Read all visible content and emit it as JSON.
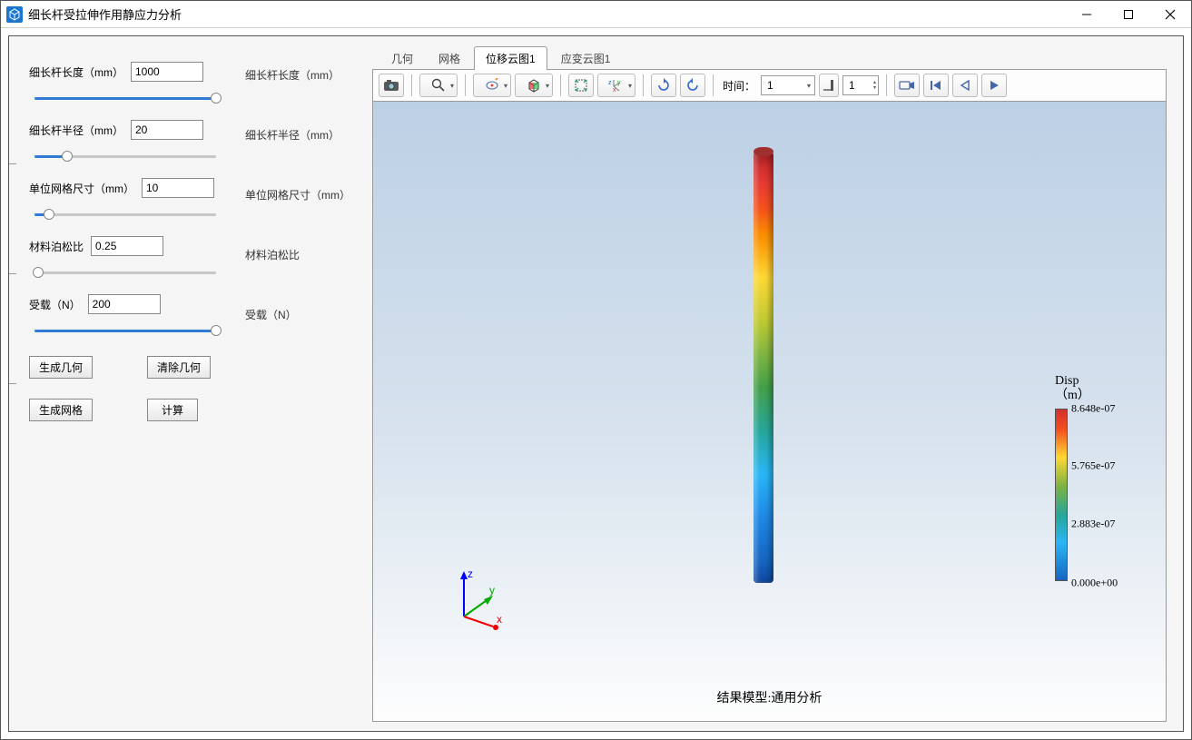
{
  "window": {
    "title": "细长杆受拉伸作用静应力分析"
  },
  "params": {
    "length": {
      "label": "细长杆长度（mm）",
      "value": "1000",
      "fill_pct": 100,
      "mirror": "细长杆长度（mm）"
    },
    "radius": {
      "label": "细长杆半径（mm）",
      "value": "20",
      "fill_pct": 18,
      "mirror": "细长杆半径（mm）"
    },
    "mesh": {
      "label": "单位网格尺寸（mm）",
      "value": "10",
      "fill_pct": 8,
      "mirror": "单位网格尺寸（mm）"
    },
    "poisson": {
      "label": "材料泊松比",
      "value": "0.25",
      "fill_pct": 2,
      "mirror": "材料泊松比"
    },
    "load": {
      "label": "受载（N）",
      "value": "200",
      "fill_pct": 100,
      "mirror": "受载（N）"
    }
  },
  "buttons": {
    "gen_geom": "生成几何",
    "clear_geom": "清除几何",
    "gen_mesh": "生成网格",
    "compute": "计算"
  },
  "tabs": {
    "items": [
      "几何",
      "网格",
      "位移云图1",
      "应变云图1"
    ],
    "active_index": 2
  },
  "toolbar": {
    "time_label": "时间：",
    "time_value": "1",
    "frame_value": "1"
  },
  "viewer": {
    "result_title": "结果模型:通用分析",
    "legend_title_1": "Disp",
    "legend_title_2": "（m）",
    "legend_ticks": [
      {
        "pct": 0,
        "label": "8.648e-07"
      },
      {
        "pct": 33,
        "label": "5.765e-07"
      },
      {
        "pct": 66,
        "label": "2.883e-07"
      },
      {
        "pct": 100,
        "label": "0.000e+00"
      }
    ],
    "axis_z": "z",
    "axis_y": "y",
    "axis_x": "x"
  }
}
